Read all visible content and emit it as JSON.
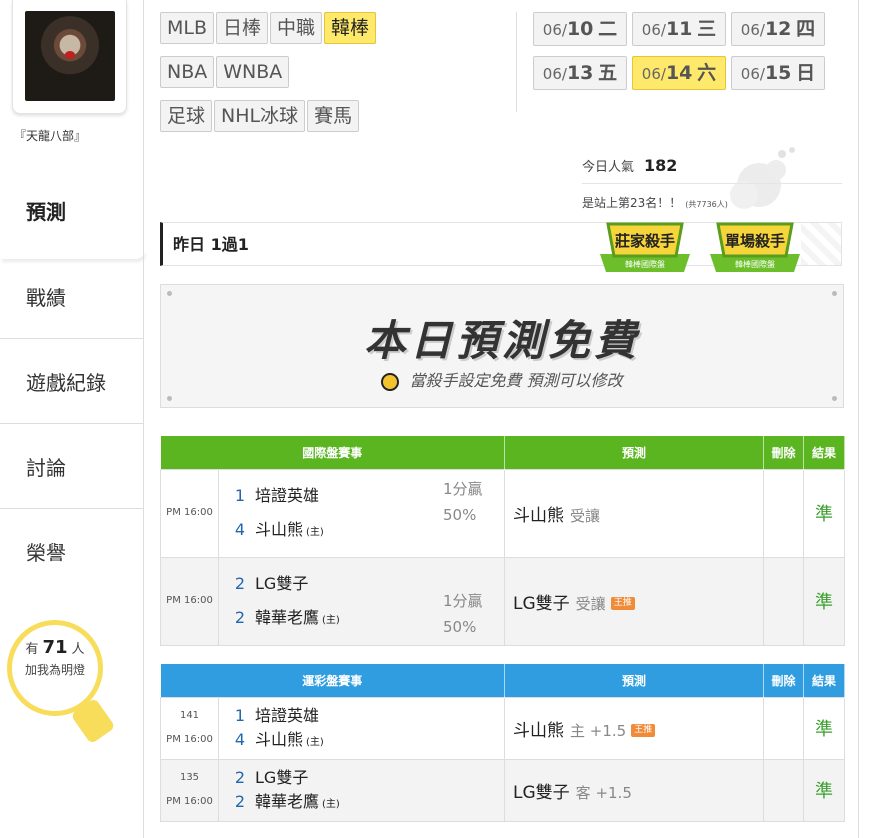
{
  "user": {
    "name": "『天龍八部』"
  },
  "nav": {
    "items": [
      "預測",
      "戰績",
      "遊戲紀錄",
      "討論",
      "榮譽"
    ]
  },
  "bulb": {
    "prefix": "有",
    "count": "71",
    "suffix": "人",
    "line2": "加我為明燈"
  },
  "categories": [
    "MLB",
    "日棒",
    "中職",
    "韓棒",
    "NBA",
    "WNBA",
    "足球",
    "NHL冰球",
    "賽馬"
  ],
  "active_category": "韓棒",
  "dates": [
    {
      "md": "06/",
      "day": "10",
      "wd": "二"
    },
    {
      "md": "06/",
      "day": "11",
      "wd": "三"
    },
    {
      "md": "06/",
      "day": "12",
      "wd": "四"
    },
    {
      "md": "06/",
      "day": "13",
      "wd": "五"
    },
    {
      "md": "06/",
      "day": "14",
      "wd": "六"
    },
    {
      "md": "06/",
      "day": "15",
      "wd": "日"
    }
  ],
  "active_date": "14",
  "popularity": {
    "label": "今日人氣",
    "value": "182",
    "rank_text": "是站上第23名！！",
    "total": "(共7736人)"
  },
  "yesterday": "昨日 1過1",
  "badges": [
    {
      "title": "莊家殺手",
      "sub": "韓棒國際盤"
    },
    {
      "title": "單場殺手",
      "sub": "韓棒國際盤"
    }
  ],
  "free": {
    "title": "本日預測免費",
    "subtitle": "當殺手設定免費 預測可以修改"
  },
  "intl": {
    "headers": [
      "國際盤賽事",
      "預測",
      "刪除",
      "結果"
    ],
    "rows": [
      {
        "time": "PM 16:00",
        "n1": "1",
        "t1": "培證英雄",
        "h1": "",
        "n2": "4",
        "t2": "斗山熊",
        "h2": "(主)",
        "line": "1分贏",
        "pct": "50%",
        "pick": "斗山熊",
        "pick_sub": "受讓",
        "tag": "",
        "result": "準"
      },
      {
        "time": "PM 16:00",
        "n1": "2",
        "t1": "LG雙子",
        "h1": "",
        "n2": "2",
        "t2": "韓華老鷹",
        "h2": "(主)",
        "line": "1分贏",
        "pct": "50%",
        "pick": "LG雙子",
        "pick_sub": "受讓",
        "tag": "王推",
        "result": "準"
      }
    ]
  },
  "lottery": {
    "headers": [
      "運彩盤賽事",
      "預測",
      "刪除",
      "結果"
    ],
    "rows": [
      {
        "id": "141",
        "time": "PM 16:00",
        "n1": "1",
        "t1": "培證英雄",
        "h1": "",
        "n2": "4",
        "t2": "斗山熊",
        "h2": "(主)",
        "pick": "斗山熊",
        "pick_sub": "主 +1.5",
        "tag": "王推",
        "result": "準"
      },
      {
        "id": "135",
        "time": "PM 16:00",
        "n1": "2",
        "t1": "LG雙子",
        "h1": "",
        "n2": "2",
        "t2": "韓華老鷹",
        "h2": "(主)",
        "pick": "LG雙子",
        "pick_sub": "客 +1.5",
        "tag": "",
        "result": "準"
      }
    ]
  }
}
